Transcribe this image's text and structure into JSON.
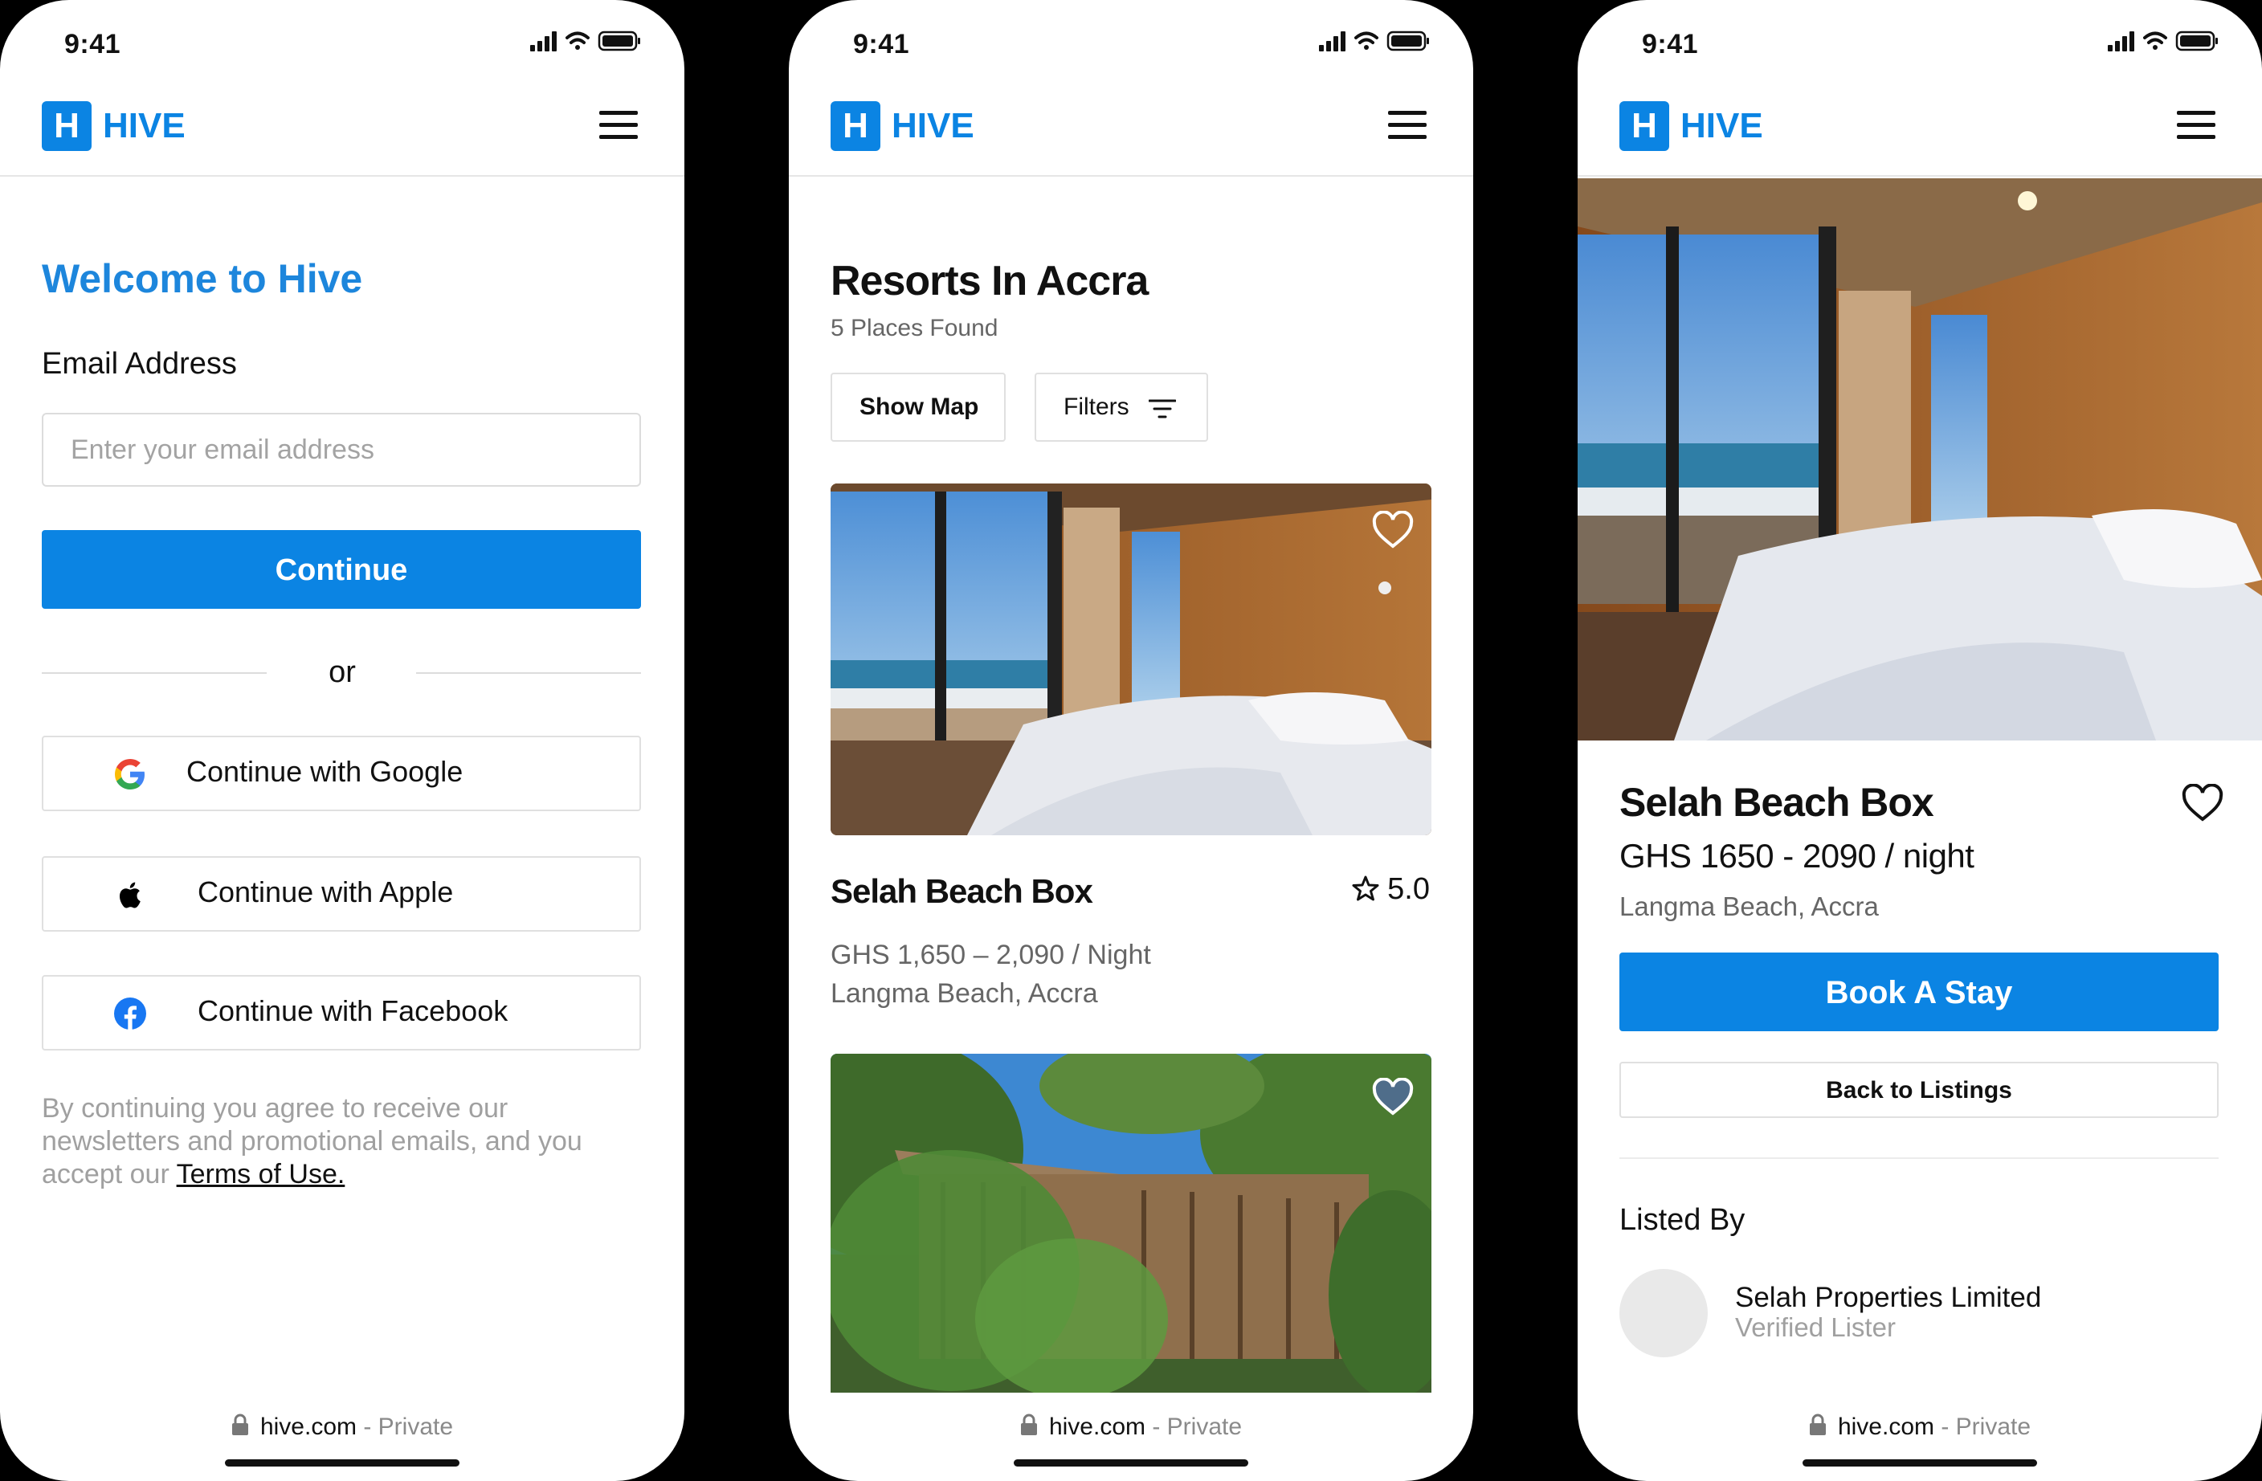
{
  "status_bar": {
    "time": "9:41"
  },
  "brand": {
    "logo_letter": "H",
    "name": "HIVE",
    "color": "#0b84e3"
  },
  "browser": {
    "domain": "hive.com",
    "mode": " - Private"
  },
  "signin": {
    "title": "Welcome to Hive",
    "email_label": "Email Address",
    "email_placeholder": "Enter your email address",
    "continue_label": "Continue",
    "or_label": "or",
    "google_label": "Continue with Google",
    "apple_label": "Continue with Apple",
    "facebook_label": "Continue with Facebook",
    "legal_text": "By continuing you agree to receive our newsletters and promotional emails, and you accept our ",
    "terms_link": "Terms of Use."
  },
  "listings": {
    "title": "Resorts In Accra",
    "count_text": "5 Places Found",
    "show_map_label": "Show Map",
    "filters_label": "Filters",
    "cards": [
      {
        "title": "Selah Beach Box",
        "rating": "5.0",
        "price": "GHS 1,650 – 2,090 / Night",
        "location": "Langma Beach, Accra",
        "favorited": false
      },
      {
        "favorited": true
      }
    ]
  },
  "detail": {
    "title": "Selah Beach Box",
    "price": "GHS 1650 - 2090 / night",
    "location": "Langma Beach, Accra",
    "book_label": "Book A Stay",
    "back_label": "Back to Listings",
    "listed_by_label": "Listed By",
    "lister_name": "Selah Properties Limited",
    "lister_status": "Verified Lister"
  }
}
